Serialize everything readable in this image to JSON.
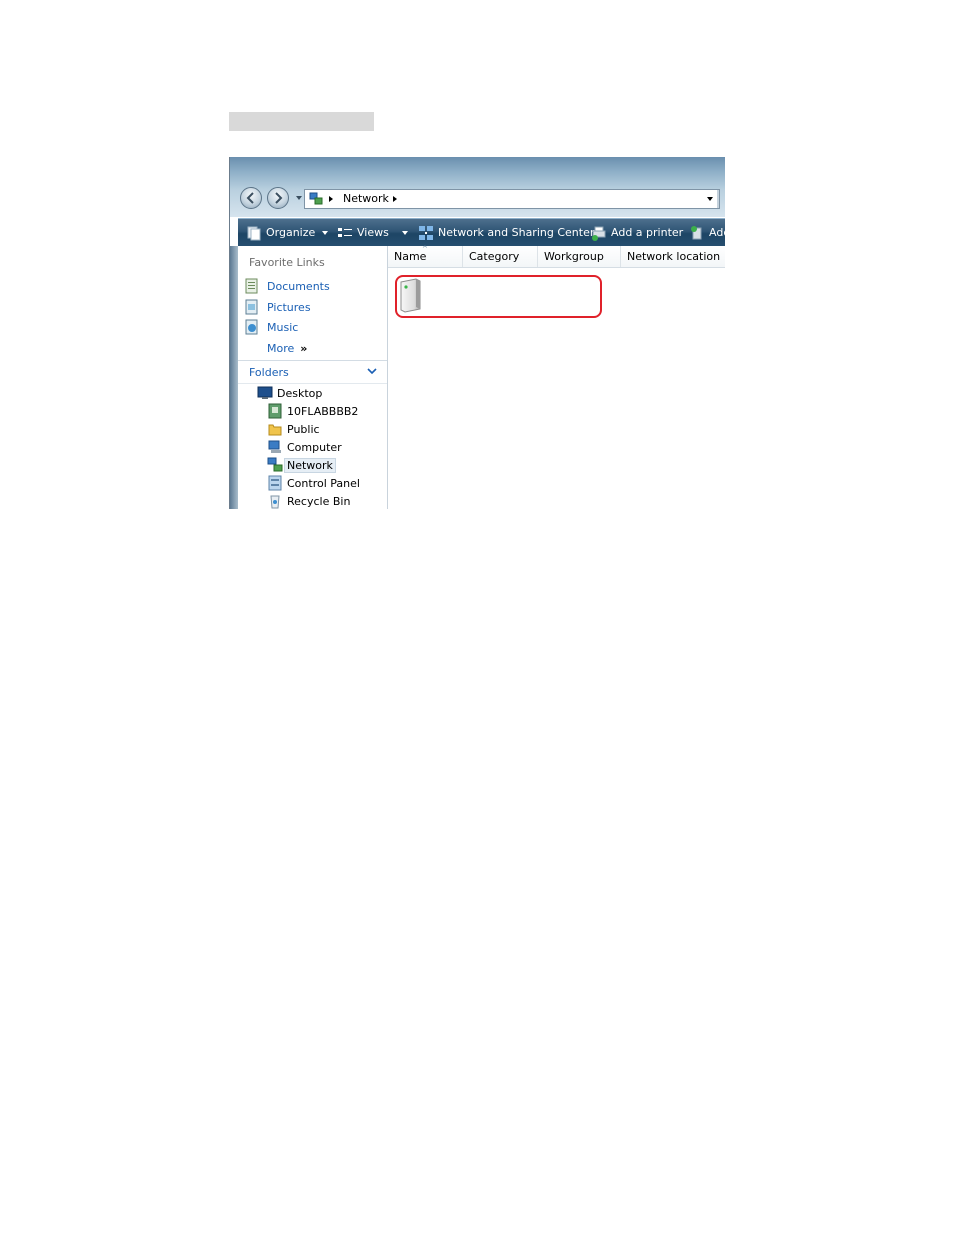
{
  "window": {
    "address": {
      "location": "Network"
    },
    "toolbar": {
      "organize": "Organize",
      "views": "Views",
      "network_sharing": "Network and Sharing Center",
      "add_printer": "Add a printer",
      "add_partial": "Add"
    },
    "nav": {
      "favorite_links_heading": "Favorite Links",
      "favorites": [
        {
          "label": "Documents",
          "icon": "documents-icon"
        },
        {
          "label": "Pictures",
          "icon": "pictures-icon"
        },
        {
          "label": "Music",
          "icon": "music-icon"
        },
        {
          "label": "More",
          "icon": ""
        }
      ],
      "more_arrows": "»",
      "folders_label": "Folders",
      "tree": [
        {
          "label": "Desktop",
          "icon": "desktop-icon"
        },
        {
          "label": "10FLABBBB2",
          "icon": "user-folder-icon"
        },
        {
          "label": "Public",
          "icon": "folder-icon"
        },
        {
          "label": "Computer",
          "icon": "computer-icon"
        },
        {
          "label": "Network",
          "icon": "network-icon",
          "selected": true
        },
        {
          "label": "Control Panel",
          "icon": "control-panel-icon"
        },
        {
          "label": "Recycle Bin",
          "icon": "recycle-bin-icon"
        }
      ]
    },
    "content": {
      "columns": [
        "Name",
        "Category",
        "Workgroup",
        "Network location"
      ],
      "items": [
        {
          "name": "",
          "icon": "network-storage-device-icon"
        }
      ],
      "highlight_color": "#e0212a"
    }
  }
}
